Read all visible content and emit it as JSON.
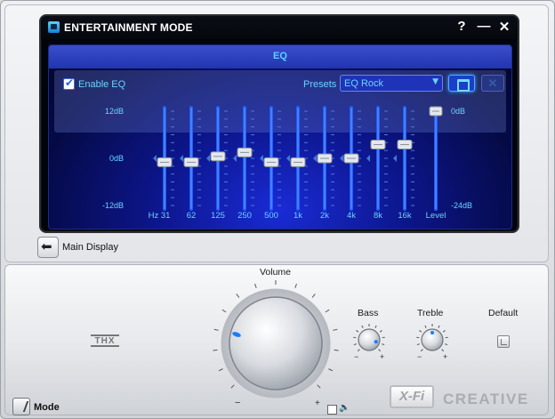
{
  "window": {
    "title": "ENTERTAINMENT MODE",
    "help_label": "?",
    "minimize_label": "—",
    "close_label": "✕"
  },
  "eq": {
    "title": "EQ",
    "enable_label": "Enable EQ",
    "enabled": true,
    "presets_label": "Presets",
    "preset_value": "EQ Rock",
    "delete_label": "✕",
    "db_top": "12dB",
    "db_mid": "0dB",
    "db_bottom": "-12dB",
    "level_top": "0dB",
    "level_bottom": "-24dB",
    "level_label": "Level",
    "bands": [
      {
        "label": "Hz 31",
        "value": -1
      },
      {
        "label": "62",
        "value": -1
      },
      {
        "label": "125",
        "value": 0.5
      },
      {
        "label": "250",
        "value": 1.5
      },
      {
        "label": "500",
        "value": -1
      },
      {
        "label": "1k",
        "value": -1
      },
      {
        "label": "2k",
        "value": 0
      },
      {
        "label": "4k",
        "value": 0
      },
      {
        "label": "8k",
        "value": 3.5
      },
      {
        "label": "16k",
        "value": 3.5
      }
    ],
    "level_value_db": 0
  },
  "nav": {
    "main_display_label": "Main Display"
  },
  "controls": {
    "volume_label": "Volume",
    "bass_label": "Bass",
    "treble_label": "Treble",
    "default_label": "Default",
    "thx_label": "THX",
    "mode_label": "Mode",
    "xfi_label": "X-Fi",
    "creative_label": "CREATIVE",
    "volume_minus": "−",
    "volume_plus": "+",
    "bass_minus": "−",
    "bass_plus": "+",
    "treble_minus": "−",
    "treble_plus": "+",
    "speaker_icon": "🔈"
  },
  "colors": {
    "eq_text": "#6ad4ff",
    "slider_blue": "#1e5bff",
    "indicator_blue": "#2a9bff"
  }
}
